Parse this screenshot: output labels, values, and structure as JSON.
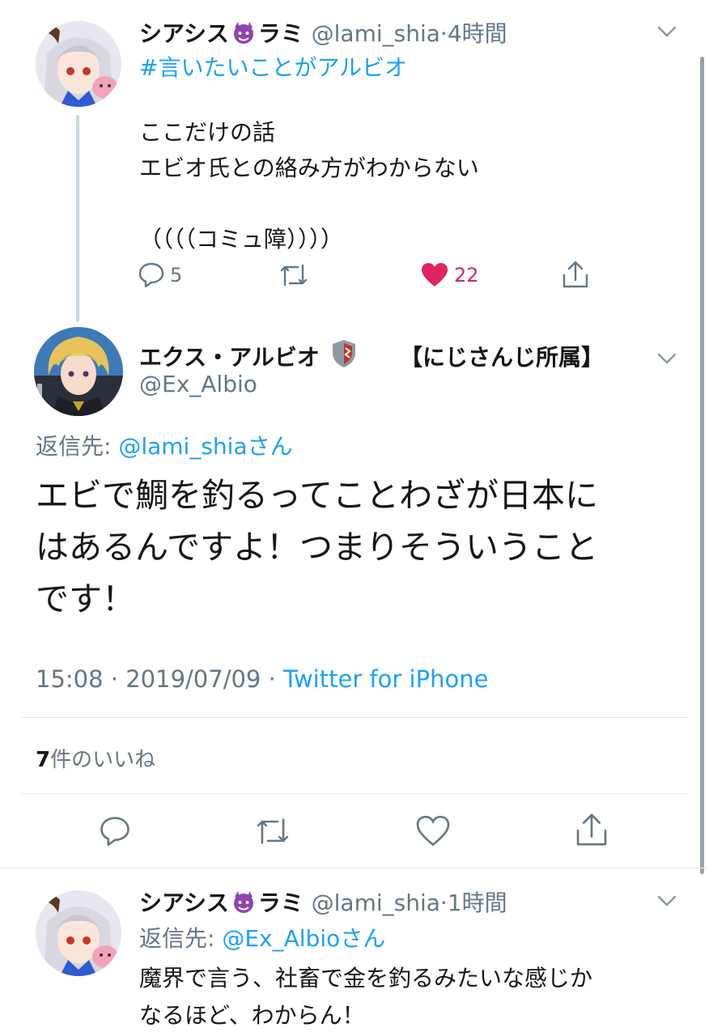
{
  "tweet1": {
    "display_name_a": "シアシス",
    "display_name_b": "ラミ",
    "handle": "@lami_shia",
    "separator": "·",
    "time": "4時間",
    "hashtag": "#言いたいことがアルビオ",
    "lines": [
      "ここだけの話",
      "エビオ氏との絡み方がわからない",
      "",
      "（（（（コミュ障））））"
    ],
    "reply_count": "5",
    "like_count": "22"
  },
  "main": {
    "display_name": "エクス・アルビオ",
    "affiliation": "【にじさんじ所属】",
    "handle": "@Ex_Albio",
    "reply_to_label": "返信先:",
    "reply_to_target": "@lami_shiaさん",
    "text_lines": [
      "エビで鯛を釣るってことわざが日本に",
      "はあるんですよ！つまりそういうこと",
      "です！"
    ],
    "time": "15:08",
    "separator": "·",
    "date": "2019/07/09",
    "client": "Twitter for iPhone",
    "likes_number": "7",
    "likes_suffix": "件のいいね"
  },
  "tweet3": {
    "display_name_a": "シアシス",
    "display_name_b": "ラミ",
    "handle": "@lami_shia",
    "separator": "·",
    "time": "1時間",
    "reply_to_label": "返信先:",
    "reply_to_target": "@Ex_Albioさん",
    "lines": [
      "魔界で言う、社畜で金を釣るみたいな感じか",
      "なるほど、わからん！"
    ]
  },
  "colors": {
    "link": "#1da1f2",
    "grey": "#657786",
    "like_red": "#e0245e",
    "divider": "#e1e8ed"
  },
  "icons": [
    "chevron-down-icon",
    "reply-icon",
    "retweet-icon",
    "heart-icon",
    "share-icon",
    "devil-emoji-icon",
    "shield-emoji-icon"
  ]
}
